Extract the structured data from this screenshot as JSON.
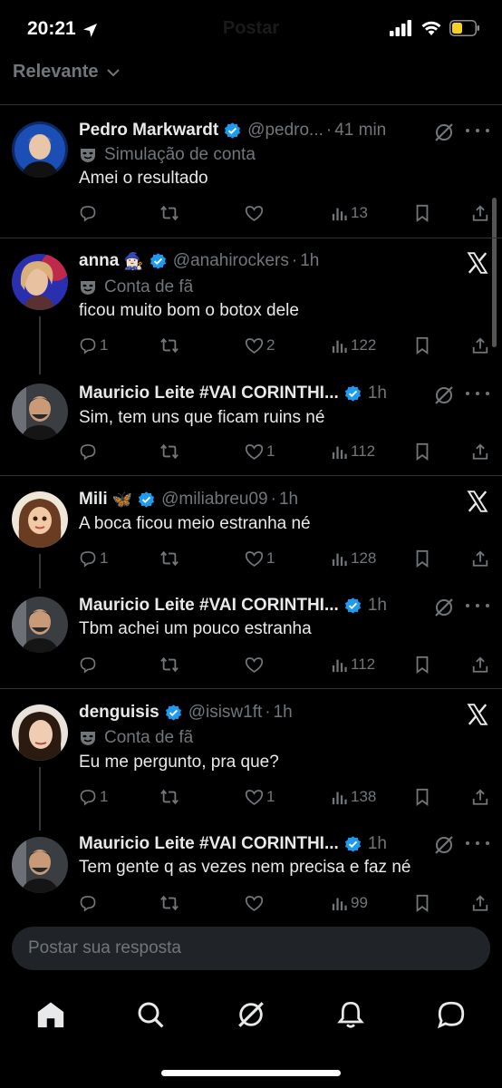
{
  "status": {
    "time": "20:21",
    "ghost_title": "Postar",
    "battery_color": "#f5d020"
  },
  "sort": {
    "label": "Relevante"
  },
  "colors": {
    "verified": "#1d9bf0",
    "muted": "#71767b"
  },
  "threads": [
    {
      "tweets": [
        {
          "name": "Pedro Markwardt",
          "handle": "@pedro...",
          "time": "41 min",
          "tag": "Simulação de conta",
          "text": "Amei o resultado",
          "right_icon": "grok-icon",
          "counts": {
            "replies": "",
            "reposts": "",
            "likes": "",
            "views": "13"
          }
        }
      ]
    },
    {
      "tweets": [
        {
          "name": "anna",
          "name_emoji": "🧙🏻‍♀️",
          "handle": "@anahirockers",
          "time": "1h",
          "tag": "Conta de fã",
          "text": "ficou muito bom o botox dele",
          "right_icon": "x-icon",
          "counts": {
            "replies": "1",
            "reposts": "",
            "likes": "2",
            "views": "122"
          }
        },
        {
          "name": "Mauricio Leite #VAI CORINTHI...",
          "time": "1h",
          "text": "Sim, tem uns que ficam ruins né",
          "right_icon": "grok-icon",
          "counts": {
            "replies": "",
            "reposts": "",
            "likes": "1",
            "views": "112"
          }
        }
      ]
    },
    {
      "tweets": [
        {
          "name": "Mili",
          "name_emoji": "🦋",
          "handle": "@miliabreu09",
          "time": "1h",
          "text": "A boca ficou meio estranha né",
          "right_icon": "x-icon",
          "counts": {
            "replies": "1",
            "reposts": "",
            "likes": "1",
            "views": "128"
          }
        },
        {
          "name": "Mauricio Leite #VAI CORINTHI...",
          "time": "1h",
          "text": "Tbm achei um pouco estranha",
          "right_icon": "grok-icon",
          "counts": {
            "replies": "",
            "reposts": "",
            "likes": "",
            "views": "112"
          }
        }
      ]
    },
    {
      "tweets": [
        {
          "name": "denguisis",
          "handle": "@isisw1ft",
          "time": "1h",
          "tag": "Conta de fã",
          "text": "Eu me pergunto, pra que?",
          "right_icon": "x-icon",
          "counts": {
            "replies": "1",
            "reposts": "",
            "likes": "1",
            "views": "138"
          }
        },
        {
          "name": "Mauricio Leite #VAI CORINTHI...",
          "time": "1h",
          "text": "Tem gente q as vezes nem precisa e faz né",
          "right_icon": "grok-icon",
          "counts": {
            "replies": "",
            "reposts": "",
            "likes": "",
            "views": "99"
          }
        }
      ]
    }
  ],
  "reply": {
    "placeholder": "Postar sua resposta"
  },
  "tabs": [
    "home-icon",
    "search-icon",
    "grok-icon",
    "notifications-icon",
    "messages-icon"
  ]
}
